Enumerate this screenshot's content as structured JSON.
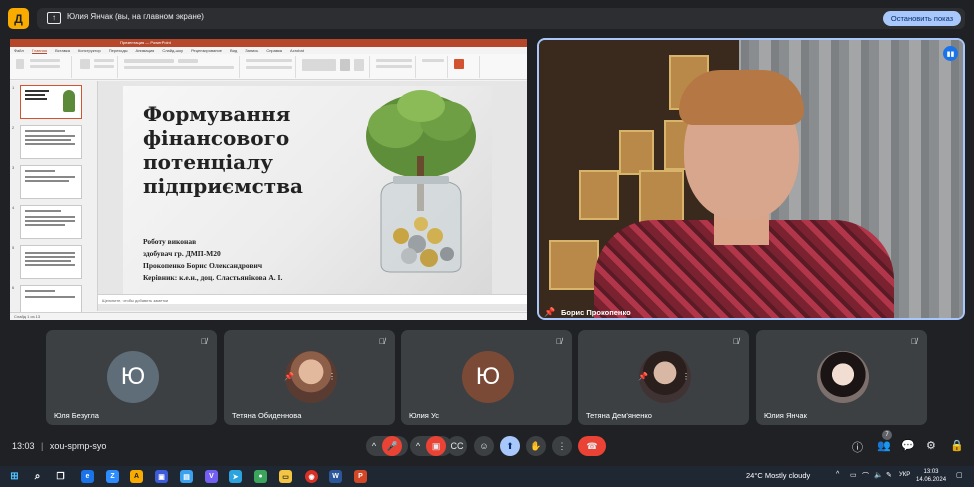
{
  "app": {
    "logo_letter": "Д"
  },
  "share_banner": {
    "text": "Юлия Янчак (вы, на главном экране)",
    "stop_label": "Остановить показ"
  },
  "presentation": {
    "window_title": "Презентация — PowerPoint",
    "tabs": [
      "Файл",
      "Главная",
      "Вставка",
      "Конструктор",
      "Переходы",
      "Анимация",
      "Слайд-шоу",
      "Рецензирование",
      "Вид",
      "Запись",
      "Справка",
      "Acrobat"
    ],
    "slide": {
      "title": "Формування фінансового потенціалу підприємства",
      "info_lines": [
        "Роботу виконав",
        "здобувач гр. ДМП-М20",
        "Прокопенко Борис Олександрович",
        "Керівник: к.е.н., доц. Сластьянікова А. І."
      ]
    },
    "thumbnail_numbers": [
      "1",
      "2",
      "3",
      "4",
      "5",
      "6"
    ],
    "notes_placeholder": "Щелкните, чтобы добавить заметки",
    "status_text": "Слайд 1 из 13"
  },
  "speaker": {
    "name": "Борис Прокопенко"
  },
  "participants": [
    {
      "name": "Юля Безугла",
      "initial": "Ю",
      "avatar_color": "#5f6d78",
      "photo": false
    },
    {
      "name": "Тетяна Обиденнова",
      "initial": "",
      "avatar_color": "",
      "photo": true
    },
    {
      "name": "Юлия Ус",
      "initial": "Ю",
      "avatar_color": "#7b4a36",
      "photo": false
    },
    {
      "name": "Тетяна Дем'яненко",
      "initial": "",
      "avatar_color": "",
      "photo": true
    },
    {
      "name": "Юлия Янчак",
      "initial": "",
      "avatar_color": "",
      "photo": true
    }
  ],
  "controls": {
    "time": "13:03",
    "separator": "|",
    "meeting_code": "xou-spmp-syo",
    "people_count": "7"
  },
  "taskbar": {
    "weather": "24°C  Mostly cloudy",
    "language": "УКР",
    "time": "13:03",
    "date": "14.06.2024"
  }
}
